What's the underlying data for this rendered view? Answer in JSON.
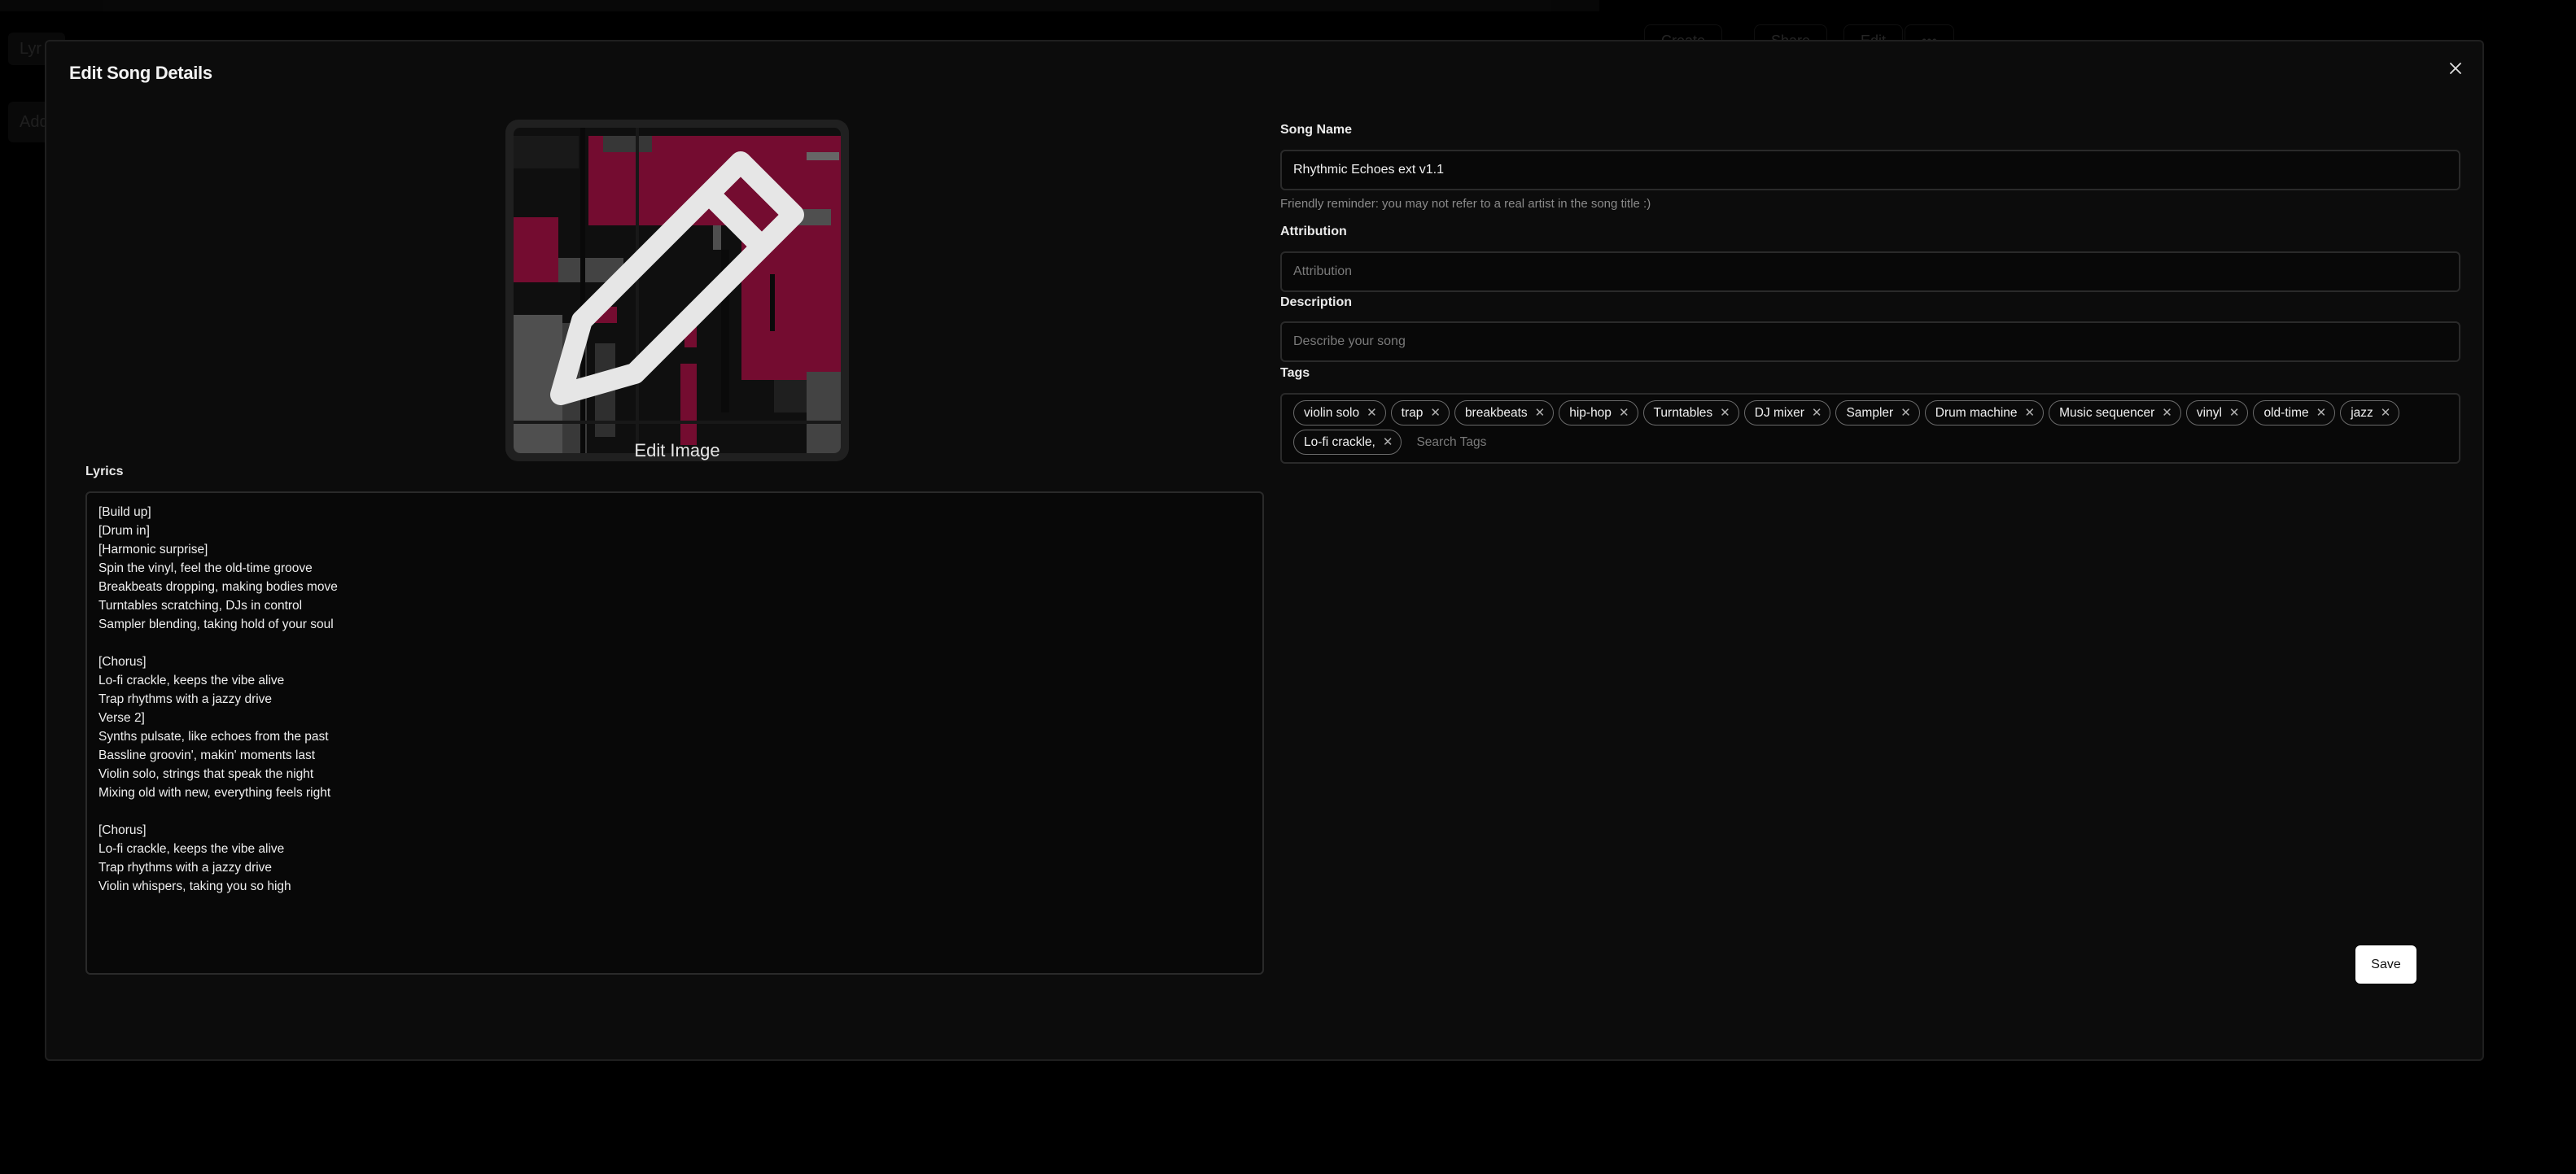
{
  "background": {
    "left_items": [
      "Lyr",
      "Add"
    ],
    "buttons": [
      "Create",
      "Share",
      "Edit",
      "•••"
    ]
  },
  "modal": {
    "title": "Edit Song Details",
    "close_icon": "close-icon"
  },
  "cover": {
    "edit_label": "Edit Image",
    "icon": "pencil-icon",
    "accent": "#b3104a"
  },
  "lyrics": {
    "label": "Lyrics",
    "value": "[Build up]\n[Drum in]\n[Harmonic surprise]\nSpin the vinyl, feel the old-time groove\nBreakbeats dropping, making bodies move\nTurntables scratching, DJs in control\nSampler blending, taking hold of your soul\n\n[Chorus]\nLo-fi crackle, keeps the vibe alive\nTrap rhythms with a jazzy drive\nVerse 2]\nSynths pulsate, like echoes from the past\nBassline groovin', makin' moments last\nViolin solo, strings that speak the night\nMixing old with new, everything feels right\n\n[Chorus]\nLo-fi crackle, keeps the vibe alive\nTrap rhythms with a jazzy drive\nViolin whispers, taking you so high"
  },
  "song_name": {
    "label": "Song Name",
    "value": "Rhythmic Echoes ext v1.1",
    "hint": "Friendly reminder: you may not refer to a real artist in the song title :)"
  },
  "attribution": {
    "label": "Attribution",
    "placeholder": "Attribution"
  },
  "description": {
    "label": "Description",
    "placeholder": "Describe your song"
  },
  "tags": {
    "label": "Tags",
    "items": [
      "violin solo",
      "trap",
      "breakbeats",
      "hip-hop",
      "Turntables",
      "DJ mixer",
      "Sampler",
      "Drum machine",
      "Music sequencer",
      "vinyl",
      "old-time",
      "jazz",
      "Lo-fi crackle,"
    ],
    "search_placeholder": "Search Tags"
  },
  "save_label": "Save"
}
